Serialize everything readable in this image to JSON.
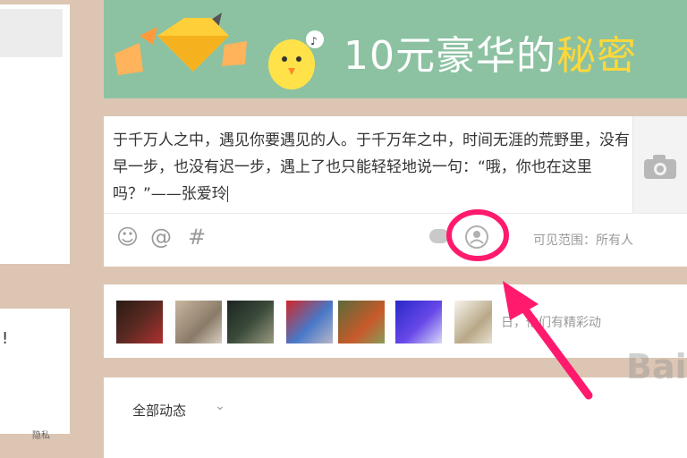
{
  "banner": {
    "text_main": "10元豪华的",
    "text_highlight": "秘密"
  },
  "composer": {
    "text": "于千万人之中，遇见你要遇见的人。于千万年之中，时间无涯的荒野里，没有早一步，也没有迟一步，遇上了也只能轻轻地说一句：“哦，你也在这里吗？”——张爱玲",
    "tools": {
      "emoji": "☺",
      "mention": "@",
      "hashtag": "#"
    },
    "visibility_label": "可见范围：",
    "visibility_value": "所有人"
  },
  "friends": {
    "text": "日，他们有精彩动"
  },
  "feed": {
    "tab_label": "全部动态",
    "chevron": "⌄"
  },
  "sidebar": {
    "mark": "!",
    "small_text": "隐私"
  },
  "watermark": "Bai",
  "colors": {
    "page_bg": "#dcc6b3",
    "banner_bg": "#8cc2a2",
    "banner_highlight": "#ffd83a",
    "annotation": "#ff1a6e"
  },
  "icons": [
    "emoji-icon",
    "at-icon",
    "hashtag-icon",
    "camera-icon",
    "cloud-icon",
    "person-circle-icon",
    "chevron-down-icon"
  ]
}
